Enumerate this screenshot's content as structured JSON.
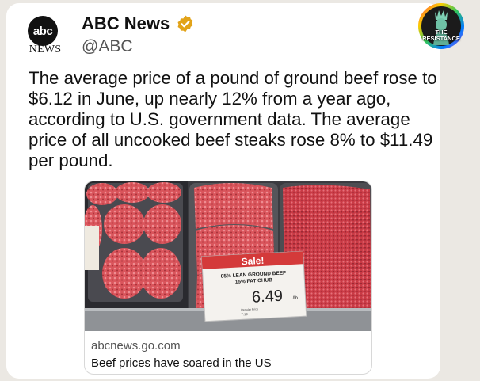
{
  "post": {
    "account_name": "ABC News",
    "handle": "@ABC",
    "avatar_logo": "abc",
    "avatar_wordmark": "NEWS",
    "text": "The average price of a pound of ground beef rose to $6.12 in June, up nearly 12% from a year ago, according to U.S. government data. The average price of all uncooked beef steaks rose 8% to $11.49 per pound."
  },
  "link_preview": {
    "domain": "abcnews.go.com",
    "title": "Beef prices have soared in the US",
    "image": {
      "sale_sign": "Sale!",
      "label_line1": "85% LEAN GROUND BEEF",
      "label_line2": "15% FAT CHUB",
      "price": "6.49",
      "unit": "/lb",
      "regular_price_label": "Regular Price",
      "regular_price": "7.19"
    }
  },
  "badge": {
    "text_line1": "THE",
    "text_line2": "RESISTANCE"
  },
  "colors": {
    "verified_gold": "#e2a319",
    "sale_red": "#d43a3a",
    "meat_red": "#c8454a"
  },
  "icons": [
    "verified-badge-icon"
  ]
}
